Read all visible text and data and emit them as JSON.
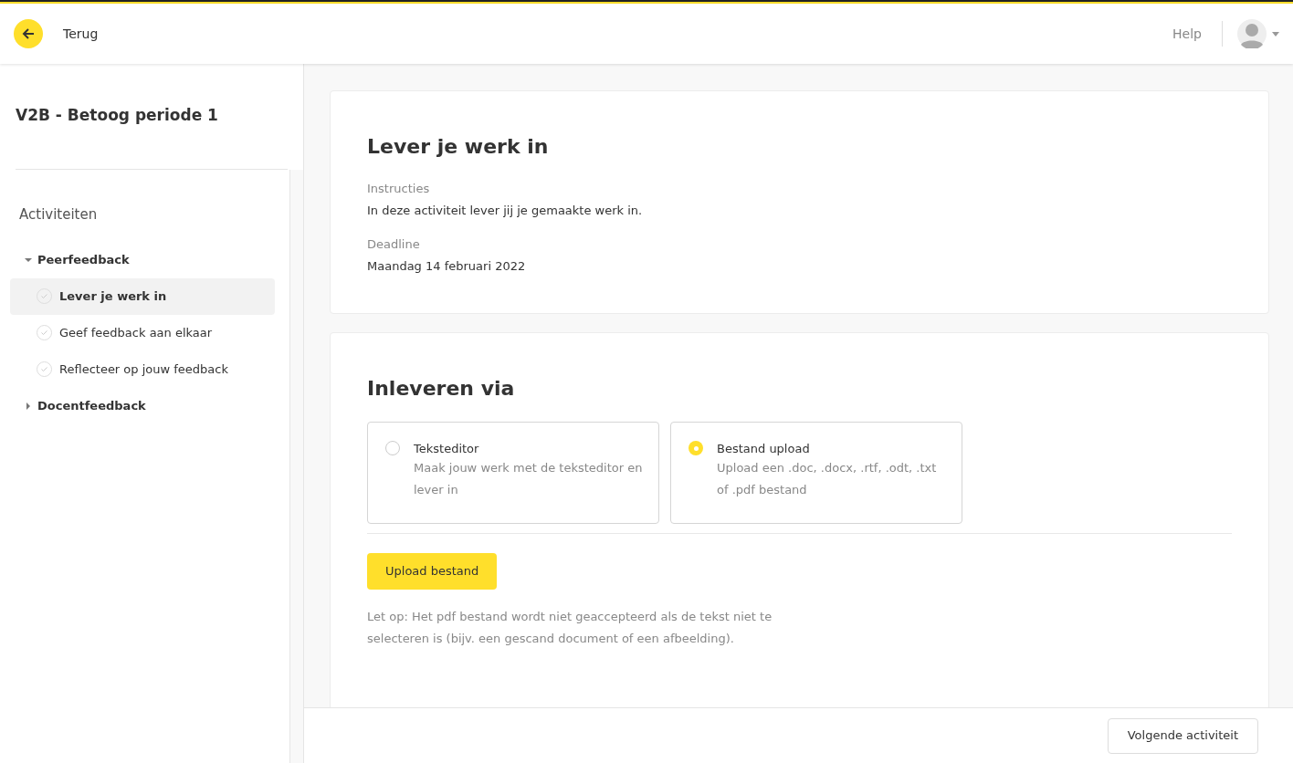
{
  "header": {
    "back_label": "Terug",
    "help": "Help"
  },
  "sidebar": {
    "title": "V2B - Betoog periode 1",
    "section": "Activiteiten",
    "groups": [
      {
        "label": "Peerfeedback",
        "expanded": true,
        "children": [
          {
            "label": "Lever je werk in",
            "selected": true
          },
          {
            "label": "Geef feedback aan elkaar",
            "selected": false
          },
          {
            "label": "Reflecteer op jouw feedback",
            "selected": false
          }
        ]
      },
      {
        "label": "Docentfeedback",
        "expanded": false
      }
    ]
  },
  "assignment": {
    "title": "Lever je werk in",
    "fields": [
      {
        "label": "Instructies",
        "value": "In deze activiteit lever jij je gemaakte werk in."
      },
      {
        "label": "Deadline",
        "value": "Maandag 14 februari 2022"
      }
    ]
  },
  "submit": {
    "title": "Inleveren via",
    "options": [
      {
        "title": "Teksteditor",
        "description": "Maak jouw werk met de teksteditor en lever in",
        "selected": false
      },
      {
        "title": "Bestand upload",
        "description": "Upload een .doc, .docx, .rtf, .odt, .txt of .pdf bestand",
        "selected": true
      }
    ],
    "button": "Upload bestand",
    "note": "Let op: Het pdf bestand wordt niet geaccepteerd als de tekst niet te selecteren is (bijv. een gescand document of een afbeelding)."
  },
  "footer": {
    "next_button": "Volgende activiteit"
  }
}
